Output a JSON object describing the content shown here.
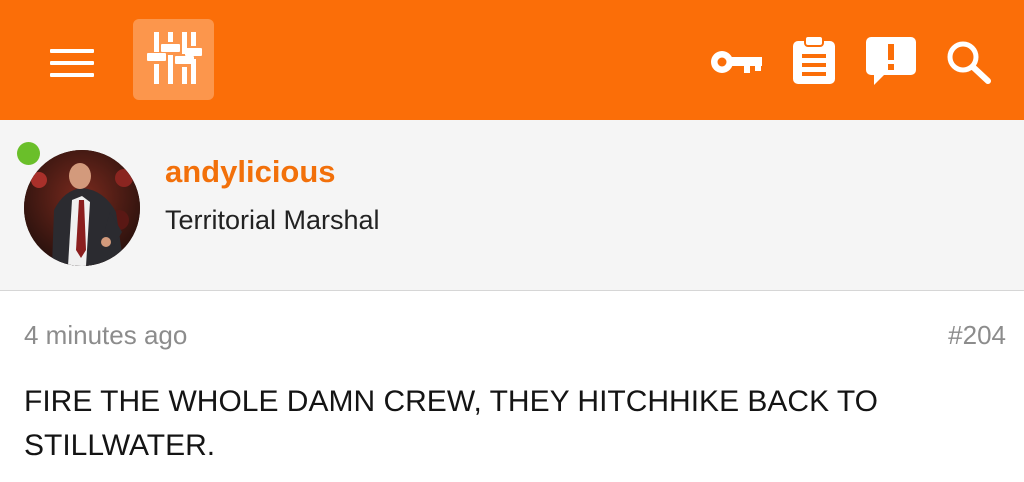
{
  "header": {
    "menu_icon": "hamburger-menu-icon",
    "logo_icon": "sliders-logo-icon",
    "actions": [
      "key-icon",
      "clipboard-icon",
      "alert-bubble-icon",
      "search-icon"
    ],
    "bar_color": "#fb6e08"
  },
  "profile": {
    "username": "andylicious",
    "user_title": "Territorial Marshal",
    "online_status": "online",
    "username_color": "#f2700a",
    "online_color": "#6abf2a"
  },
  "post": {
    "time": "4 minutes ago",
    "number": "#204",
    "body": "FIRE THE WHOLE DAMN CREW, THEY HITCHHIKE BACK TO STILLWATER."
  }
}
